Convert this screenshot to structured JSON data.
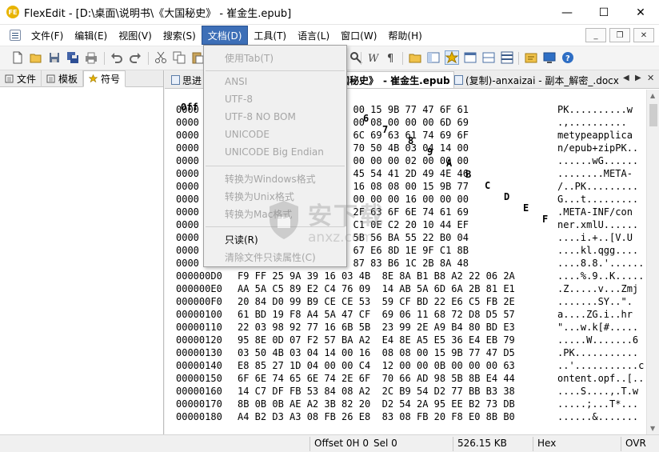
{
  "app": {
    "icon_text": "FE",
    "title": "FlexEdit - [D:\\桌面\\说明书\\《大国秘史》 - 崔金生.epub]"
  },
  "window_controls": {
    "minimize": "—",
    "maximize": "☐",
    "close": "✕"
  },
  "menubar": {
    "items": [
      "文件(F)",
      "编辑(E)",
      "视图(V)",
      "搜索(S)",
      "文档(D)",
      "工具(T)",
      "语言(L)",
      "窗口(W)",
      "帮助(H)"
    ],
    "active_index": 4,
    "mdi": {
      "minimize": "_",
      "restore": "❐",
      "close": "✕"
    }
  },
  "side_panel": {
    "tabs": [
      "文件",
      "模板",
      "符号"
    ],
    "active_tab": "符号"
  },
  "doc_tabs": {
    "tab1": "思进",
    "tab2_prefix": "国秘史》",
    "tab2": "- 崔金生.epub",
    "tab3": "(复制)-anxaizai - 副本_解密_.docx",
    "nav_left": "◀",
    "nav_right": "▶",
    "close": "✕"
  },
  "hex_header": {
    "offset_label": "Off",
    "columns": [
      "6",
      "7",
      "8",
      "9",
      "A",
      "B",
      "C",
      "D",
      "E",
      "F"
    ]
  },
  "hex_rows": [
    {
      "off": "0000",
      "bytes": "          16 08  00 00 15 9B 77 47 6F 61",
      "ascii": "PK..........w"
    },
    {
      "off": "0000",
      "bytes": "          14 00  00 00 08 00 00 00 6D 69",
      "ascii": ".,.........."
    },
    {
      "off": "0000",
      "bytes": "          61 70  70 6C 69 63 61 74 69 6F",
      "ascii": "metypeapplica"
    },
    {
      "off": "0000",
      "bytes": "          2B 7A  69 70 50 4B 03 04 14 00",
      "ascii": "n/epub+zipPK.."
    },
    {
      "off": "0000",
      "bytes": "          77 47  00 00 00 00 02 00 00 00",
      "ascii": "......wG......"
    },
    {
      "off": "0000",
      "bytes": "          00 00  4D 45 54 41 2D 49 4E 46",
      "ascii": "........META-"
    },
    {
      "off": "0000",
      "bytes": "          04 14  00 16 08 08 00 15 9B 77",
      "ascii": "/..PK........."
    },
    {
      "off": "0000",
      "bytes": "          00 00  F4 00 00 00 16 00 00 00",
      "ascii": "G...t........."
    },
    {
      "off": "0000",
      "bytes": "          49 4E  46 2F 63 6F 6E 74 61 69",
      "ascii": ".META-INF/con"
    },
    {
      "off": "0000",
      "bytes": "          6C 55  8E C1 0E C2 20 10 44 EF",
      "ascii": "ner.xmlU......"
    },
    {
      "off": "0000",
      "bytes": "          2B 81  F6 5B 56 BA 55 22 B0 04",
      "ascii": "....i.+..[V.U"
    },
    {
      "off": "0000",
      "bytes": "          EA 71  67 67 E6 8D 1E 9F C1 8B",
      "ascii": "....kl.qgg...."
    },
    {
      "off": "0000",
      "bytes": "          F7 27  18 87 83 B6 1C 2B 8A 48",
      "ascii": "....8.8.'......"
    },
    {
      "off": "000000D0",
      "bytes": "F9 FF 25 9A 39 16 03 4B  8E 8A B1 B8 A2 22 06 2A",
      "ascii": "....%.9..K....."
    },
    {
      "off": "000000E0",
      "bytes": "AA 5A C5 89 E2 C4 76 09  14 AB 5A 6D 6A 2B 81 E1",
      "ascii": ".Z.....v...Zmj"
    },
    {
      "off": "000000F0",
      "bytes": "20 84 D0 99 B9 CE CE 53  59 CF BD 22 E6 C5 FB 2E",
      "ascii": ".......SY..\"."
    },
    {
      "off": "00000100",
      "bytes": "61 BD 19 F8 A4 5A 47 CF  69 06 11 68 72 D8 D5 57",
      "ascii": "a....ZG.i..hr"
    },
    {
      "off": "00000110",
      "bytes": "22 03 98 92 77 16 6B 5B  23 99 2E A9 B4 80 BD E3",
      "ascii": "\"...w.k[#....."
    },
    {
      "off": "00000120",
      "bytes": "95 8E 0D 07 F2 57 BA A2  E4 8E A5 E5 36 E4 EB 79",
      "ascii": ".....W.......6"
    },
    {
      "off": "00000130",
      "bytes": "03 50 4B 03 04 14 00 16  08 08 00 15 9B 77 47 D5",
      "ascii": ".PK..........."
    },
    {
      "off": "00000140",
      "bytes": "E8 85 27 1D 04 00 00 C4  12 00 00 0B 00 00 00 63",
      "ascii": "..'...........c"
    },
    {
      "off": "00000150",
      "bytes": "6F 6E 74 65 6E 74 2E 6F  70 66 AD 98 5B 8B E4 44",
      "ascii": "ontent.opf..[.."
    },
    {
      "off": "00000160",
      "bytes": "14 C7 DF FB 53 84 08 A2  2C B9 54 D2 77 BB B3 38",
      "ascii": "....S....,.T.w"
    },
    {
      "off": "00000170",
      "bytes": "8B 0B 0B AE A2 3B 82 20  D2 54 2A 95 EE B2 73 DB",
      "ascii": ".....;...T*..."
    },
    {
      "off": "00000180",
      "bytes": "A4 B2 D3 A3 08 FB 26 E8  83 08 FB 20 F8 E0 8B B0",
      "ascii": "......&......."
    }
  ],
  "document_menu": {
    "items": [
      {
        "label": "使用Tab(T)",
        "enabled": false
      },
      {
        "label": "ANSI",
        "enabled": false
      },
      {
        "label": "UTF-8",
        "enabled": false
      },
      {
        "label": "UTF-8 NO BOM",
        "enabled": false
      },
      {
        "label": "UNICODE",
        "enabled": false
      },
      {
        "label": "UNICODE Big Endian",
        "enabled": false
      },
      {
        "label": "转换为Windows格式",
        "enabled": false
      },
      {
        "label": "转换为Unix格式",
        "enabled": false
      },
      {
        "label": "转换为Mac格式",
        "enabled": false
      },
      {
        "label": "只读(R)",
        "enabled": true
      },
      {
        "label": "清除文件只读属性(C)",
        "enabled": false
      }
    ]
  },
  "watermark": {
    "text": "安下载",
    "sub": "anxz.com"
  },
  "statusbar": {
    "offset": "Offset 0H 0",
    "sel": "Sel 0",
    "size": "526.15 KB",
    "mode": "Hex",
    "ovr": "OVR"
  },
  "colors": {
    "menu_active": "#3d6fb7",
    "disabled_text": "#a6a6a6",
    "icon_blue": "#2e6ec4",
    "icon_yellow": "#e8b400"
  }
}
